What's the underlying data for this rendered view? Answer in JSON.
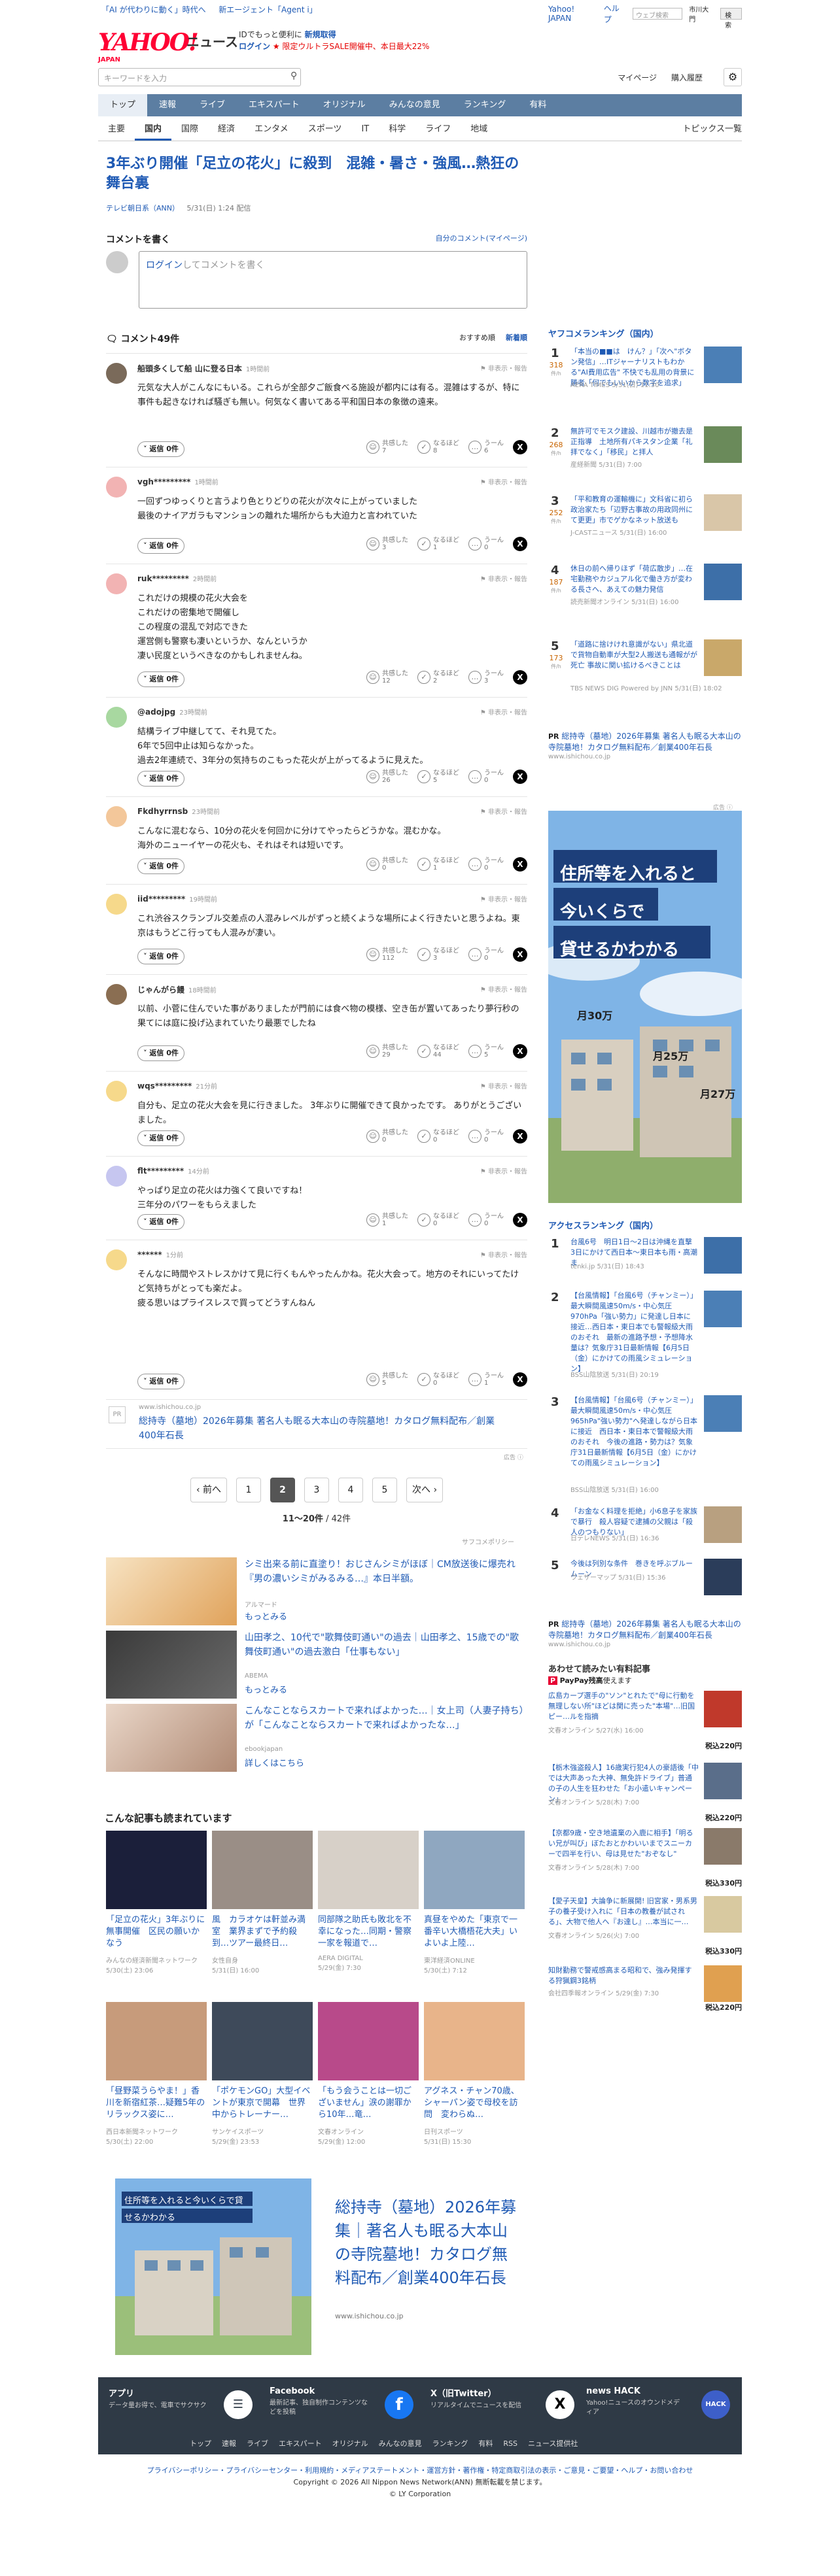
{
  "top": {
    "left_links": [
      "「AI が代わりに動く」時代へ",
      "新エージェント「Agent i」"
    ],
    "right_links": [
      "Yahoo! JAPAN",
      "ヘルプ"
    ],
    "search_placeholder": "ウェブ検索",
    "radio_label": "市川大門",
    "search_button": "検索"
  },
  "brand": {
    "logo": "YAHOO!",
    "logo_sub": "JAPAN",
    "news": "ニュース",
    "promo_line1_prefix": "IDでもっと便利に",
    "promo_line1_link": "新規取得",
    "promo_line2_link": "ログイン",
    "promo_line2_text": "★ 限定ウルトラSALE開催中、本日最大22%"
  },
  "search": {
    "placeholder": "キーワードを入力",
    "links": [
      "マイページ",
      "購入履歴"
    ]
  },
  "nav": {
    "main": [
      "トップ",
      "速報",
      "ライブ",
      "エキスパート",
      "オリジナル",
      "みんなの意見",
      "ランキング",
      "有料"
    ],
    "sub": [
      "主要",
      "国内",
      "国際",
      "経済",
      "エンタメ",
      "スポーツ",
      "IT",
      "科学",
      "ライフ",
      "地域"
    ],
    "topics": "トピックス一覧"
  },
  "article": {
    "title": "3年ぶり開催「足立の花火」に殺到　混雑・暑さ・強風…熱狂の舞台裏",
    "source": "テレビ朝日系（ANN）",
    "date": "5/31(日) 1:24 配信"
  },
  "comment_form": {
    "heading": "コメントを書く",
    "mine": "自分のコメント(マイページ)",
    "login": "ログイン",
    "placeholder_rest": "してコメントを書く"
  },
  "comments_header": {
    "count": "コメント49件",
    "sort_recommend": "おすすめ順",
    "sort_new": "新着順"
  },
  "comments": [
    {
      "user": "船頭多くして船 山に登る日本",
      "time": "1時間前",
      "body": "元気な大人がこんなにもいる。これらが全部夕ご飯食べる施設が都内には有る。混雑はするが、特に事件も起きなければ騒ぎも無い。何気なく書いてある平和国日本の象徴の遠来。",
      "votes": [
        "7",
        "8",
        "6"
      ]
    },
    {
      "user": "vgh*********",
      "time": "1時間前",
      "body": "一回ずつゆっくりと言うより色とりどりの花火が次々に上がっていました\n最後のナイアガラもマンションの離れた場所からも大迫力と言われていた",
      "votes": [
        "3",
        "1",
        "0"
      ]
    },
    {
      "user": "ruk*********",
      "time": "2時間前",
      "body": "これだけの規模の花火大会を\nこれだけの密集地で開催し\nこの程度の混乱で対応できた\n運営側も警察も凄いというか、なんというか\n凄い民度というべきなのかもしれませんね。",
      "votes": [
        "12",
        "2",
        "3"
      ]
    },
    {
      "user": "@adojpg",
      "time": "23時間前",
      "body": "結構ライブ中継してて、それ見てた。\n6年で5回中止は知らなかった。\n過去2年連続で、3年分の気持ちのこもった花火が上がってるように見えた。",
      "votes": [
        "26",
        "5",
        "0"
      ]
    },
    {
      "user": "Fkdhyrrnsb",
      "time": "23時間前",
      "body": "こんなに混むなら、10分の花火を何回かに分けてやったらどうかな。混むかな。\n海外のニューイヤーの花火も、それはそれは短いです。",
      "votes": [
        "0",
        "1",
        "0"
      ]
    },
    {
      "user": "iid*********",
      "time": "19時間前",
      "body": "これ渋谷スクランブル交差点の人混みレベルがずっと続くような場所によく行きたいと思うよね。東京はもうどこ行っても人混みが凄い。",
      "votes": [
        "112",
        "3",
        "0"
      ]
    },
    {
      "user": "じゃんがら饅",
      "time": "18時間前",
      "body": "以前、小菅に住んでいた事がありましたが門前には食べ物の模様、空き缶が置いてあったり夢行秒の果てには庭に投げ込まれていたり最悪でしたね",
      "votes": [
        "29",
        "44",
        "5"
      ]
    },
    {
      "user": "wqs*********",
      "time": "21分前",
      "body": "自分も、足立の花火大会を見に行きました。 3年ぶりに開催できて良かったです。 ありがとうございました。",
      "votes": [
        "0",
        "0",
        "0"
      ]
    },
    {
      "user": "flt*********",
      "time": "14分前",
      "body": "やっぱり足立の花火は力強くて良いですね！\n三年分のパワーをもらえました",
      "votes": [
        "1",
        "0",
        "0"
      ]
    },
    {
      "user": "******",
      "time": "1分前",
      "body": "そんなに時間やストレスかけて見に行くもんやったんかね。花火大会って。地方のそれにいってたけど気持ちがとっても楽だよ。\n疲る思いはプライスレスで買ってどうすんねん",
      "votes": [
        "5",
        "0",
        "1"
      ]
    }
  ],
  "vote_labels": {
    "agree": "共感した",
    "understand": "なるほど",
    "hmm": "うーん"
  },
  "reply_label": "返信",
  "flags_label": "非表示・報告",
  "pr": {
    "url": "www.ishichou.co.jp",
    "title": "総持寺（墓地）2026年募集 著名人も眠る大本山の寺院墓地！カタログ無料配布／創業400年石長"
  },
  "pager": {
    "prev": "前へ",
    "pages": [
      "1",
      "2",
      "3",
      "4",
      "5"
    ],
    "next": "次へ",
    "current": "2",
    "count": "11〜20件",
    "total": "/ 42件"
  },
  "sponsored_policy": "サフコメポリシー",
  "sponsored": [
    {
      "title": "シミ出来る前に直塗り！おじさんシミがほぼ｜CM放送後に爆売れ『男の濃いシミがみるみる…』本日半額。",
      "src": "アルマード",
      "more": "もっとみる"
    },
    {
      "title": "山田孝之、10代で\"歌舞伎町通い\"の過去｜山田孝之、15歳での\"歌舞伎町通い\"の過去激白「仕事もない」",
      "src": "ABEMA",
      "more": "もっとみる"
    },
    {
      "title": "こんなことならスカートで来ればよかった…｜女上司（人妻子持ち）が「こんなことならスカートで来ればよかったな…」",
      "src": "ebookjapan",
      "more": "詳しくはこちら"
    }
  ],
  "also": {
    "heading": "こんな記事も読まれています",
    "items": [
      {
        "title": "「足立の花火」3年ぶりに無事開催　区民の願いかなう",
        "src": "みんなの経済新聞ネットワーク",
        "date": "5/30(土) 23:06"
      },
      {
        "title": "風　カラオケは軒並み満室　業界まずで予約殺到…ツアー最終日…",
        "src": "女性自身",
        "date": "5/31(日) 16:00"
      },
      {
        "title": "同部隊之助氏も敗北を不幸になった…同期・警察一家を報道で…",
        "src": "AERA DIGITAL",
        "date": "5/29(金) 7:30"
      },
      {
        "title": "真昼をやめた「東京で一番辛い大橋梧花大夫」いよいよ上陸…",
        "src": "東洋経済ONLINE",
        "date": "5/30(土) 7:12"
      },
      {
        "title": "「昼野菜うらやま！」香川を新宿紅茶…疑難5年のリラックス姿に…",
        "src": "西日本新聞ネットワーク",
        "date": "5/30(土) 22:00"
      },
      {
        "title": "「ポケモンGO」大型イベントが東京で開幕　世界中からトレーナー…",
        "src": "サンケイスポーツ",
        "date": "5/29(金) 23:53"
      },
      {
        "title": "「もう会うことは一切ございません」涙の謝罪から10年…竜…",
        "src": "文春オンライン",
        "date": "5/29(金) 12:00"
      },
      {
        "title": "アグネス・チャン70歳、シャーパン姿で母校を訪問　変わらぬ…",
        "src": "日刊スポーツ",
        "date": "5/31(日) 15:30"
      }
    ]
  },
  "bottom_ad": {
    "image_text": "住所等を入れると今いくらで貸せるかわかる",
    "title": "総持寺（墓地）2026年募集｜著名人も眠る大本山の寺院墓地！カタログ無料配布／創業400年石長",
    "url": "www.ishichou.co.jp"
  },
  "right": {
    "yafukome_title": "ヤフコメランキング（国内）",
    "yafukome": [
      {
        "n": "1",
        "cnt": "318",
        "title": "「本当の■■は　けん？」「次へ\"ボタン発信」…ITジャーナリストもわかる\"AI費用広告\" 不快でも乱用の背景に勝者「何でもいいから数字を追求」",
        "src": "AERA TIMES 5/31(日) 11:30"
      },
      {
        "n": "2",
        "cnt": "268",
        "title": "無許可でモスク建設、川越市が撤去是正指導　土地所有パキスタン企業「礼拝でなく」「移民」と拝人",
        "src": "産経新聞 5/31(日) 7:00"
      },
      {
        "n": "3",
        "cnt": "252",
        "title": "「平和教育の運輸機に」文科省に初ら政治家たち「辺野古事故の用政同州にて更更」市でゲかなネット放送も",
        "src": "J-CASTニュース 5/31(日) 16:00"
      },
      {
        "n": "4",
        "cnt": "187",
        "title": "休日の前へ帰りほず「荷広散步」…在宅勤務やカジュアル化で働き方が変わる長さへ、あえての魅力発信",
        "src": "読売新聞オンライン 5/31(日) 16:00"
      },
      {
        "n": "5",
        "cnt": "173",
        "title": "「道路に捨けけれ意識がない」県北道で貨物自動車が大型2人搬送も通報がが死亡 事故に関い拡けるべきことは",
        "src": "TBS NEWS DIG Powered by JNN 5/31(日) 18:02"
      }
    ],
    "count_unit": "件/h",
    "pr1_title": "総持寺（墓地）2026年募集 著名人も眠る大本山の寺院墓地！カタログ無料配布／創業400年石長",
    "pr1_url": "www.ishichou.co.jp",
    "ad_text": [
      "住所等を入れると",
      "今いくらで",
      "貸せるかわかる"
    ],
    "ad_prices": [
      "月30万",
      "月25万",
      "月27万"
    ],
    "access_title": "アクセスランキング（国内）",
    "access": [
      {
        "n": "1",
        "title": "台風6号　明日1日〜2日は沖縄を直撃　3日にかけて西日本〜東日本も雨・高潮ま",
        "src": "tenki.jp 5/31(日) 18:43"
      },
      {
        "n": "2",
        "title": "【台風情報】「台風6号（チャンミー）」最大瞬間風速50m/s・中心気圧970hPa「強い勢力」に発達し日本に接近…西日本・東日本でも警報級大雨のおそれ　最新の進路予想・予想降水量は？気象庁31日最新情報【6月5日（金）にかけての雨風シミュレーション】",
        "src": "BSS山陰放送 5/31(日) 20:19"
      },
      {
        "n": "3",
        "title": "【台風情報】「台風6号（チャンミー）」最大瞬間風速50m/s・中心気圧965hPa\"強い勢力\"へ発達しながら日本に接近　西日本・東日本で警報級大雨のおそれ　今後の進路・勢力は？気象庁31日最新情報【6月5日（金）にかけての雨風シミュレーション】",
        "src": "BSS山陰放送 5/31(日) 16:00"
      },
      {
        "n": "4",
        "title": "「お金なく料理を拒絶」小6息子を家族で暴行　殺人容疑で逮捕の父親は「殺人のつもりない」",
        "src": "日テレNEWS 5/31(日) 16:36"
      },
      {
        "n": "5",
        "title": "今後は列別な条件　巻きを呼ぶブルームーン",
        "src": "ウェザーマップ 5/31(日) 15:36"
      }
    ],
    "pr2_title": "総持寺（墓地）2026年募集 著名人も眠る大本山の寺院墓地！カタログ無料配布／創業400年石長",
    "pr2_url": "www.ishichou.co.jp",
    "mag_title": "あわせて読みたい有料記事",
    "paypay": "PayPay残高",
    "paypay_rest": "使えます",
    "mag": [
      {
        "title": "広島カープ選手の\"ソン\"とれたで\"母に行動を無理しない所\"ほどは関に売った\"本場\"…旧国ピー…ルを指摘",
        "src": "文春オンライン 5/27(水) 16:00",
        "price": "税込220円"
      },
      {
        "title": "【栃木強盗殺人】16歳実行犯4人の豪語後「中では大声あった大神、無免許ドライブ」普通の子の人生を狂わせた「お小遣いキャンペーン」",
        "src": "文春オンライン 5/28(木) 7:00",
        "price": "税込220円"
      },
      {
        "title": "【京都9歳・空き地遺棄の入鹿に相手】「明るい兄が叫び」ぼたおとかわいいまでスニーカーで四半を行い、母は見せた\"おぞなし\"",
        "src": "文春オンライン 5/28(木) 7:00",
        "price": "税込330円"
      },
      {
        "title": "【愛子天皇】大論争に新展開! 旧宮家・男系男子の養子受け入れに「日本の教養が試される」、大物で他人へ『お達し』…本当に一…",
        "src": "文春オンライン 5/26(火) 7:00",
        "price": "税込330円"
      },
      {
        "title": "知財勤務で警戒感高まる昭和で、強み発揮する狩猟鋼3銘柄",
        "src": "会社四季報オンライン 5/29(金) 7:30",
        "price": "税込220円"
      }
    ]
  },
  "footer": {
    "cells": [
      {
        "h": "アプリ",
        "p": "データ量お得で、電車でサクサク"
      },
      {
        "h": "Facebook",
        "p": "最新記事、独自制作コンテンツなどを投稿"
      },
      {
        "h": "X（旧Twitter）",
        "p": "リアルタイムでニュースを配信"
      },
      {
        "h": "news HACK",
        "p": "Yahoo!ニュースのオウンドメディア"
      }
    ],
    "nav": [
      "トップ",
      "速報",
      "ライブ",
      "エキスパート",
      "オリジナル",
      "みんなの意見",
      "ランキング",
      "有料",
      "RSS",
      "ニュース提供社"
    ],
    "legal1": "プライバシーポリシー・プライバシーセンター・利用規約・メディアステートメント・運営方針・著作権・特定商取引法の表示・ご意見・ご要望・ヘルプ・お問い合わせ",
    "legal2": "Copyright © 2026 All Nippon News Network(ANN) 無断転載を禁じます。",
    "legal3": "© LY Corporation"
  },
  "colors": {
    "brand_red": "#ff0033",
    "link_blue": "#1f5ab4",
    "nav_blue": "#5c7ea2",
    "footer_dark": "#2f3a46"
  }
}
